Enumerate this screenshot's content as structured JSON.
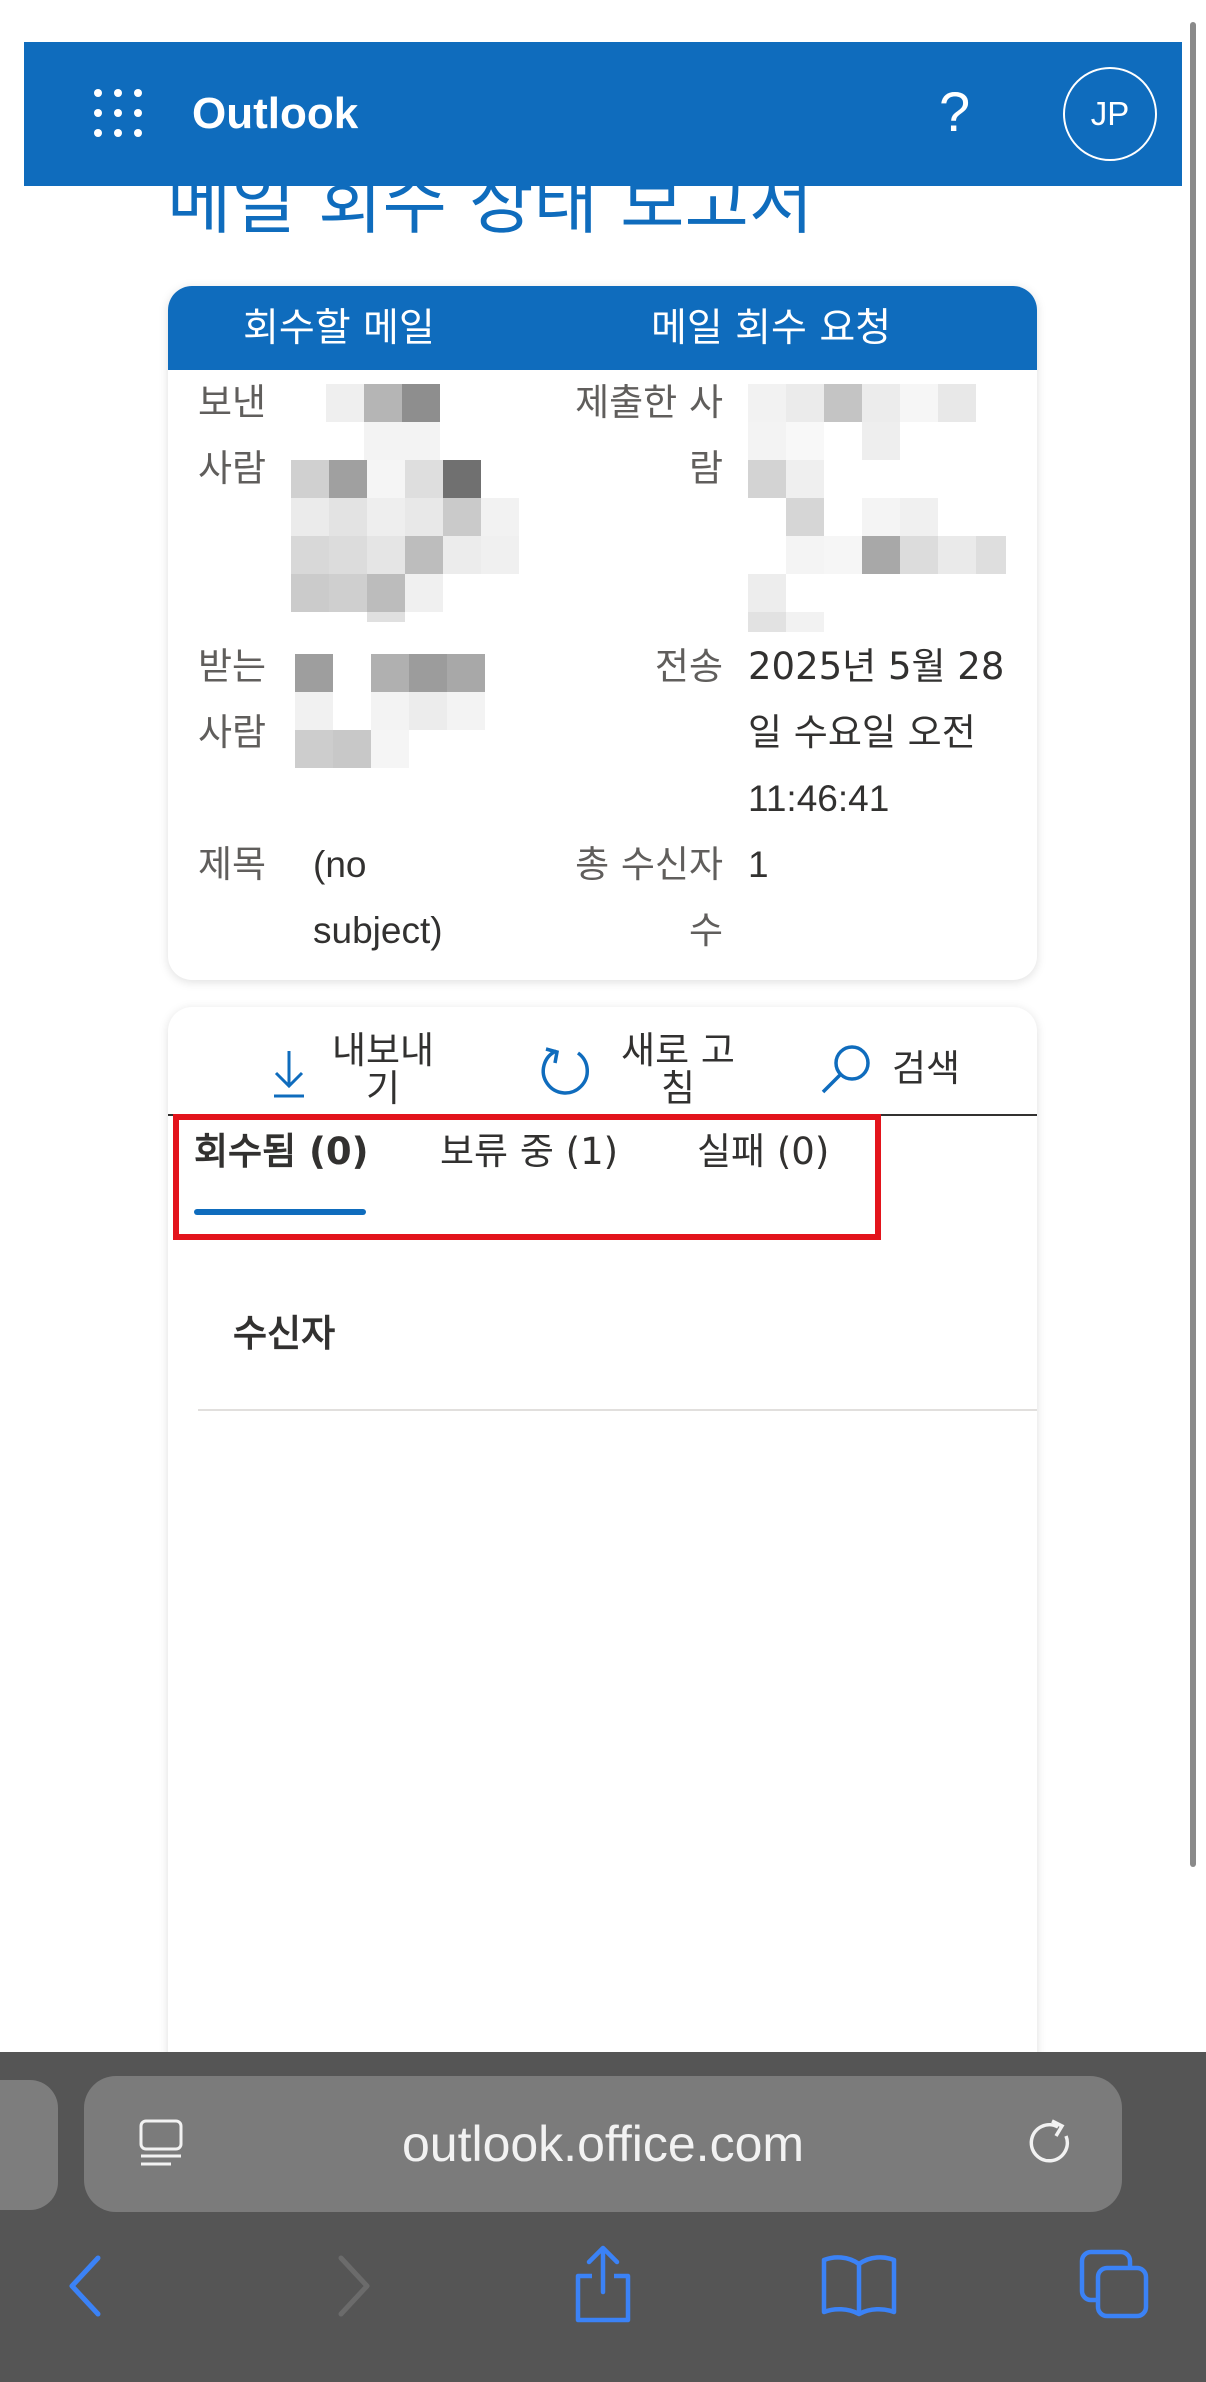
{
  "header": {
    "app_name": "Outlook",
    "help_label": "?",
    "avatar_initials": "JP",
    "color": "#0f6cbd"
  },
  "page": {
    "title": "메일 회수 상태 보고서"
  },
  "summary_card": {
    "headers": [
      "회수할 메일",
      "메일 회수 요청"
    ],
    "sender_label_1": "보낸",
    "sender_label_2": "사람",
    "submitter_label_1": "제출한 사",
    "submitter_label_2": "람",
    "recipient_label_1": "받는",
    "recipient_label_2": "사람",
    "sent_label": "전송",
    "sent_value_1": "2025년 5월 28",
    "sent_value_2": "일 수요일 오전",
    "sent_value_3": "11:46:41",
    "subject_label": "제목",
    "subject_value_1": "(no",
    "subject_value_2": "subject)",
    "total_label_1": "총 수신자",
    "total_label_2": "수",
    "total_value": "1"
  },
  "toolbar": {
    "export_label_1": "내보내",
    "export_label_2": "기",
    "refresh_label_1": "새로 고",
    "refresh_label_2": "침",
    "search_label": "검색"
  },
  "tabs": [
    {
      "label": "회수됨 (0)",
      "active": true
    },
    {
      "label": "보류 중 (1)",
      "active": false
    },
    {
      "label": "실패 (0)",
      "active": false
    }
  ],
  "table": {
    "column_header": "수신자"
  },
  "browser": {
    "url": "outlook.office.com",
    "icons": [
      "reader-icon",
      "reload-icon",
      "back-icon",
      "forward-icon",
      "share-icon",
      "bookmarks-icon",
      "tabs-icon"
    ]
  }
}
